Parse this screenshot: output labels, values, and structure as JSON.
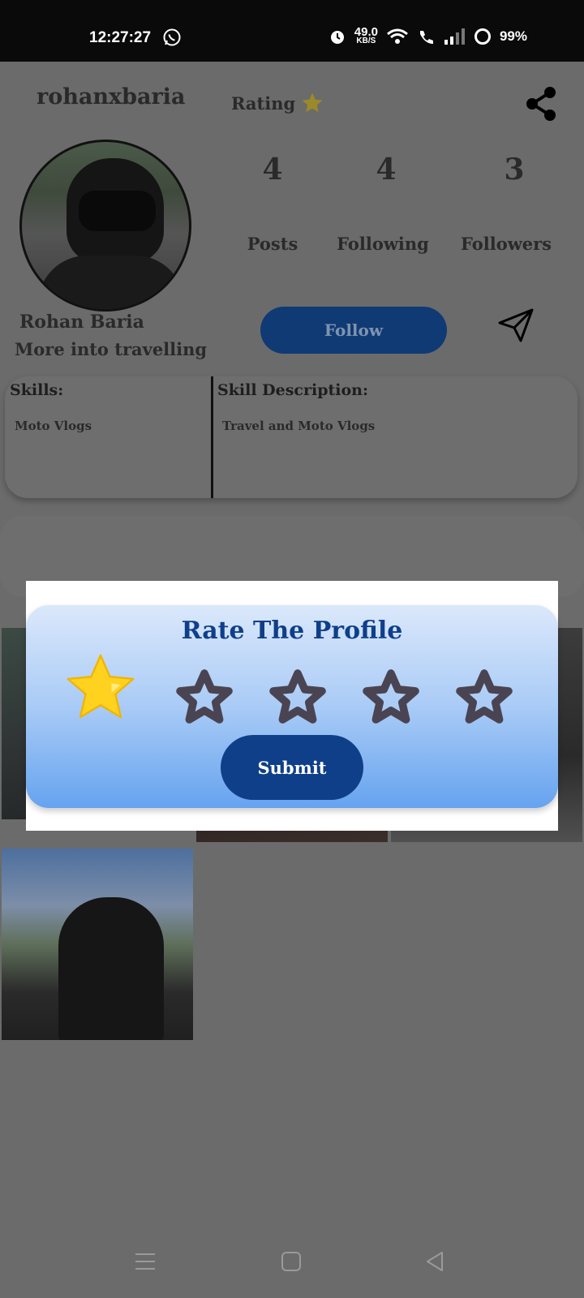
{
  "status_bar": {
    "time": "12:27:27",
    "net_speed": "49.0",
    "net_unit": "KB/S",
    "battery": "99%"
  },
  "profile": {
    "username": "rohanxbaria",
    "rating_label": "Rating",
    "stats": [
      {
        "value": "4",
        "label": "Posts"
      },
      {
        "value": "4",
        "label": "Following"
      },
      {
        "value": "3",
        "label": "Followers"
      }
    ],
    "full_name": "Rohan Baria",
    "bio": "More into travelling",
    "follow_label": "Follow"
  },
  "skills": {
    "title": "Skills:",
    "value": "Moto Vlogs",
    "desc_title": "Skill Description:",
    "desc_value": "Travel and Moto Vlogs"
  },
  "dialog": {
    "title": "Rate The Profile",
    "selected_stars": 1,
    "total_stars": 5,
    "submit_label": "Submit"
  },
  "colors": {
    "accent": "#0f3f88",
    "star_filled": "#ffd21f",
    "star_empty": "#4a4452"
  },
  "icons": [
    "whatsapp-icon",
    "alarm-icon",
    "wifi-icon",
    "call-icon",
    "signal-icon",
    "battery-icon",
    "star-icon",
    "share-icon",
    "send-icon",
    "menu-icon",
    "home-icon",
    "back-icon"
  ]
}
